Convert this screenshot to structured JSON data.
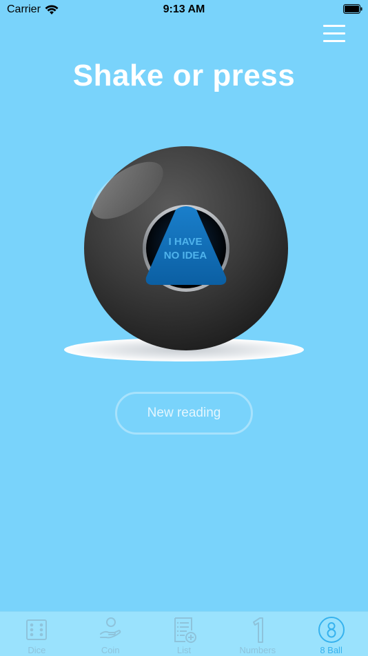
{
  "status_bar": {
    "carrier": "Carrier",
    "time": "9:13 AM"
  },
  "header": {
    "menu_icon": "hamburger-menu-icon",
    "title": "Shake or press"
  },
  "magic_ball": {
    "answer_line1": "I HAVE",
    "answer_line2": "NO IDEA"
  },
  "actions": {
    "new_reading_label": "New reading"
  },
  "tabs": [
    {
      "label": "Dice",
      "icon": "dice-icon",
      "active": false
    },
    {
      "label": "Coin",
      "icon": "coin-hand-icon",
      "active": false
    },
    {
      "label": "List",
      "icon": "list-add-icon",
      "active": false
    },
    {
      "label": "Numbers",
      "icon": "number-one-icon",
      "active": false
    },
    {
      "label": "8 Ball",
      "icon": "eight-ball-icon",
      "active": true
    }
  ],
  "colors": {
    "background": "#79d3fb",
    "tab_bar": "#9ae2fd",
    "tab_inactive": "#8ec3db",
    "tab_active": "#36b2ee",
    "ball": "#3a3a3a",
    "answer_triangle": "#0d6db3"
  }
}
